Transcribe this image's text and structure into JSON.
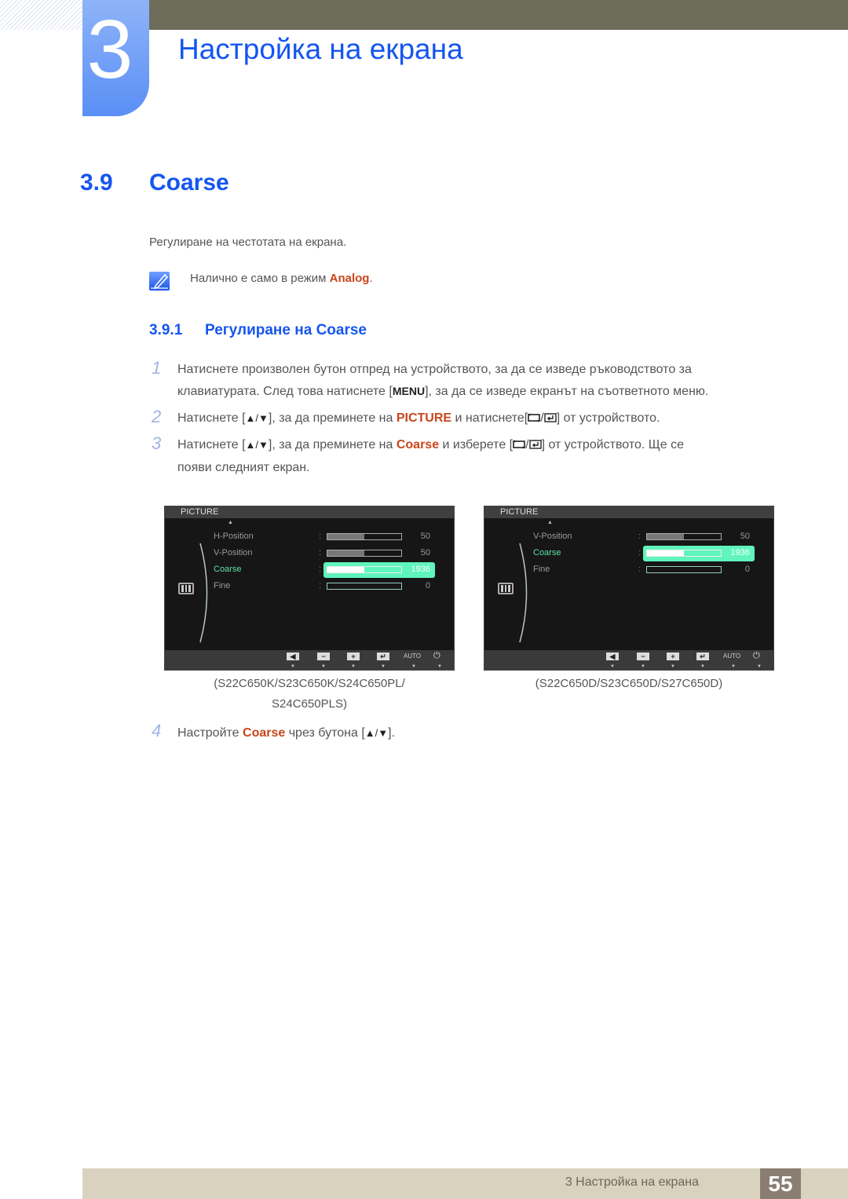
{
  "header": {
    "chapter_number": "3",
    "chapter_title": "Настройка на екрана"
  },
  "section": {
    "number": "3.9",
    "title": "Coarse",
    "description": "Регулиране на честотата на екрана.",
    "note": {
      "icon": "note-pencil-icon",
      "text_before": "Налично е само в режим ",
      "highlight": "Analog",
      "text_after": "."
    }
  },
  "subsection": {
    "number": "3.9.1",
    "title": "Регулиране на Coarse"
  },
  "steps": [
    {
      "n": "1",
      "lines": [
        "Натиснете произволен бутон отпред на устройството, за да се изведе ръководството за",
        "клавиатурата. След това натиснете [",
        "MENU",
        "], за да се изведе екранът на съответното меню."
      ]
    },
    {
      "n": "2",
      "prefix": "Натиснете [",
      "arrows": "▲/▼",
      "middle": "], за да преминете на ",
      "highlight": "PICTURE",
      "after_highlight": " и натиснете[",
      "suffix": "] от устройството."
    },
    {
      "n": "3",
      "prefix": "Натиснете [",
      "arrows": "▲/▼",
      "middle": "], за да преминете на ",
      "highlight": "Coarse",
      "after_highlight": " и изберете [",
      "suffix": "] от устройството. Ще се",
      "line2": "появи следният екран."
    },
    {
      "n": "4",
      "prefix": "Настройте ",
      "highlight": "Coarse",
      "middle": " чрез бутона [",
      "arrows": "▲/▼",
      "suffix": "]."
    }
  ],
  "osd_screens": [
    {
      "menu_title": "PICTURE",
      "rows": [
        {
          "label": "H-Position",
          "value": "50",
          "fill": 0.5,
          "active": false
        },
        {
          "label": "V-Position",
          "value": "50",
          "fill": 0.5,
          "active": false
        },
        {
          "label": "Coarse",
          "value": "1936",
          "fill": 0.5,
          "active": true
        },
        {
          "label": "Fine",
          "value": "0",
          "fill": 0,
          "active": false
        }
      ],
      "footer_buttons": [
        "◀",
        "−",
        "+",
        "↵",
        "AUTO",
        "⏻"
      ],
      "caption_line1": "(S22C650K/S23C650K/S24C650PL/",
      "caption_line2": "S24C650PLS)"
    },
    {
      "menu_title": "PICTURE",
      "rows": [
        {
          "label": "V-Position",
          "value": "50",
          "fill": 0.5,
          "active": false
        },
        {
          "label": "Coarse",
          "value": "1936",
          "fill": 0.5,
          "active": true
        },
        {
          "label": "Fine",
          "value": "0",
          "fill": 0,
          "active": false
        }
      ],
      "footer_buttons": [
        "◀",
        "−",
        "+",
        "↵",
        "AUTO",
        "⏻"
      ],
      "caption_line1": "(S22C650D/S23C650D/S27C650D)"
    }
  ],
  "footer": {
    "text": "3 Настройка на екрана",
    "page_number": "55"
  },
  "colors": {
    "accent_blue": "#1555f0",
    "highlight_orange": "#c8461b",
    "osd_active": "#5ff5bd",
    "header_bar": "#6e6c5a",
    "footer_bar": "#d9d2bf",
    "page_box": "#8a7e73"
  }
}
